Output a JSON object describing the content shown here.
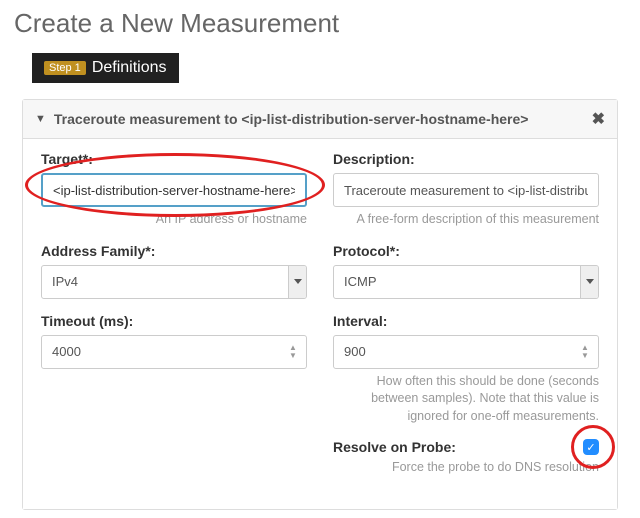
{
  "page_title": "Create a New Measurement",
  "step": {
    "badge": "Step 1",
    "label": "Definitions"
  },
  "panel": {
    "title": "Traceroute measurement to <ip-list-distribution-server-hostname-here>"
  },
  "fields": {
    "target": {
      "label": "Target*:",
      "value": "<ip-list-distribution-server-hostname-here>",
      "hint": "An IP address or hostname"
    },
    "description": {
      "label": "Description:",
      "value": "Traceroute measurement to <ip-list-distributio",
      "hint": "A free-form description of this measurement"
    },
    "address_family": {
      "label": "Address Family*:",
      "value": "IPv4"
    },
    "protocol": {
      "label": "Protocol*:",
      "value": "ICMP"
    },
    "timeout": {
      "label": "Timeout (ms):",
      "value": "4000"
    },
    "interval": {
      "label": "Interval:",
      "value": "900",
      "hint": "How often this should be done (seconds between samples). Note that this value is ignored for one-off measurements."
    },
    "resolve_on_probe": {
      "label": "Resolve on Probe:",
      "checked": true,
      "hint": "Force the probe to do DNS resolution"
    }
  }
}
